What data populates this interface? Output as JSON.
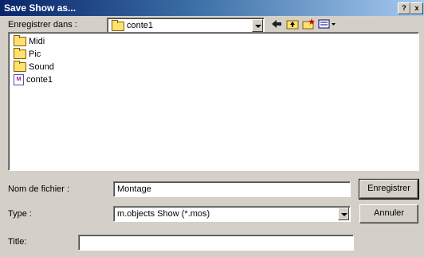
{
  "window": {
    "title": "Save Show as...",
    "help_label": "?",
    "close_label": "x"
  },
  "save_in": {
    "label": "Enregistrer dans :",
    "value": "conte1"
  },
  "toolbar": {
    "back_icon": "back-arrow-icon",
    "up_icon": "up-folder-icon",
    "new_folder_icon": "new-folder-icon",
    "view_icon": "view-menu-icon"
  },
  "files": [
    {
      "name": "Midi",
      "type": "folder"
    },
    {
      "name": "Pic",
      "type": "folder"
    },
    {
      "name": "Sound",
      "type": "folder"
    },
    {
      "name": "conte1",
      "type": "show-file"
    }
  ],
  "filename": {
    "label": "Nom de fichier :",
    "value": "Montage"
  },
  "filetype": {
    "label": "Type :",
    "value": "m.objects Show (*.mos)"
  },
  "title_field": {
    "label": "Title:",
    "value": ""
  },
  "buttons": {
    "save": "Enregistrer",
    "cancel": "Annuler"
  }
}
